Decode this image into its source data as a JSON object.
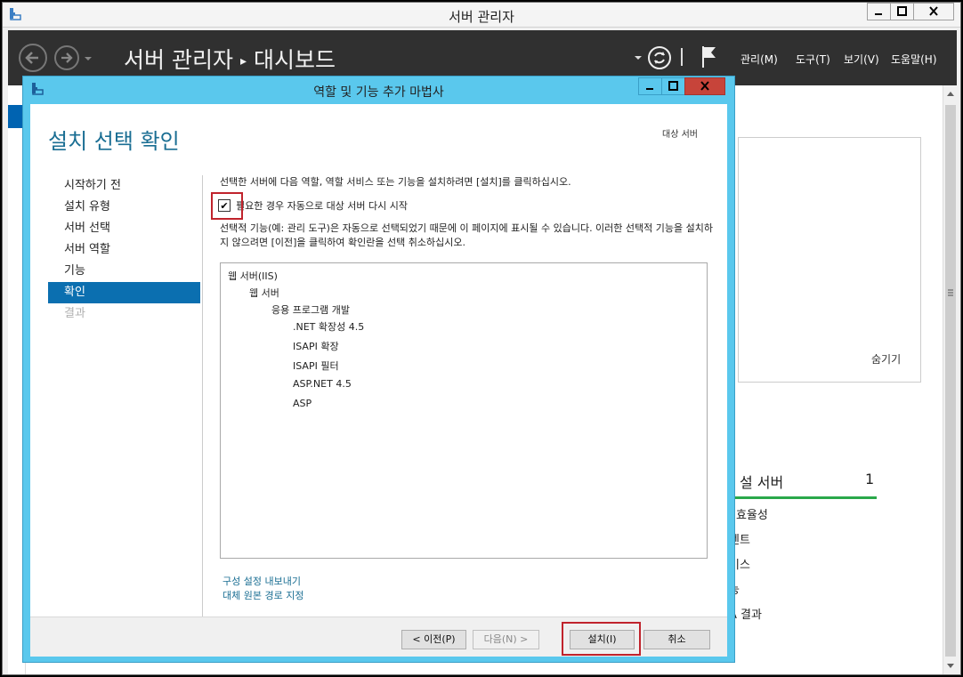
{
  "server_manager": {
    "window_title": "서버 관리자",
    "breadcrumb_root": "서버 관리자",
    "breadcrumb_sep": "▸",
    "breadcrumb_current": "대시보드",
    "menu": {
      "manage": "관리(M)",
      "tools": "도구(T)",
      "view": "보기(V)",
      "help": "도움말(H)"
    },
    "tile": {
      "hide_link": "숨기기"
    },
    "server_tile": {
      "title": "설 서버",
      "count": "1",
      "items": [
        "I 효율성",
        "벤트",
        "비스",
        "능",
        "A 결과"
      ]
    }
  },
  "wizard": {
    "title": "역할 및 기능 추가 마법사",
    "heading": "설치 선택 확인",
    "target_label": "대상 서버",
    "nav": [
      {
        "label": "시작하기 전",
        "state": "normal"
      },
      {
        "label": "설치 유형",
        "state": "normal"
      },
      {
        "label": "서버 선택",
        "state": "normal"
      },
      {
        "label": "서버 역할",
        "state": "normal"
      },
      {
        "label": "기능",
        "state": "normal"
      },
      {
        "label": "확인",
        "state": "active"
      },
      {
        "label": "결과",
        "state": "disabled"
      }
    ],
    "intro": "선택한 서버에 다음 역할, 역할 서비스 또는 기능을 설치하려면 [설치]를 클릭하십시오.",
    "restart_checkbox": {
      "label": "필요한 경우 자동으로 대상 서버 다시 시작",
      "checked": true,
      "glyph": "✔"
    },
    "note": "선택적 기능(예: 관리 도구)은 자동으로 선택되었기 때문에 이 페이지에 표시될 수 있습니다. 이러한 선택적 기능을 설치하지 않으려면 [이전]을 클릭하여 확인란을 선택 취소하십시오.",
    "features": [
      {
        "label": "웹 서버(IIS)",
        "level": 0
      },
      {
        "label": "웹 서버",
        "level": 1
      },
      {
        "label": "응용 프로그램 개발",
        "level": 2
      },
      {
        "label": ".NET 확장성 4.5",
        "level": 3
      },
      {
        "label": "ISAPI 확장",
        "level": 3
      },
      {
        "label": "ISAPI 필터",
        "level": 3
      },
      {
        "label": "ASP.NET 4.5",
        "level": 3
      },
      {
        "label": "ASP",
        "level": 3
      }
    ],
    "links": {
      "export": "구성 설정 내보내기",
      "source": "대체 원본 경로 지정"
    },
    "buttons": {
      "previous": "< 이전(P)",
      "next": "다음(N) >",
      "install": "설치(I)",
      "cancel": "취소"
    }
  },
  "colors": {
    "wizard_frame": "#5ac8ed",
    "heading": "#1a6e93",
    "nav_active": "#0b6fb0",
    "highlight_box": "#c0232c",
    "header_bar": "#303030",
    "tile_accent": "#2aa84a"
  }
}
